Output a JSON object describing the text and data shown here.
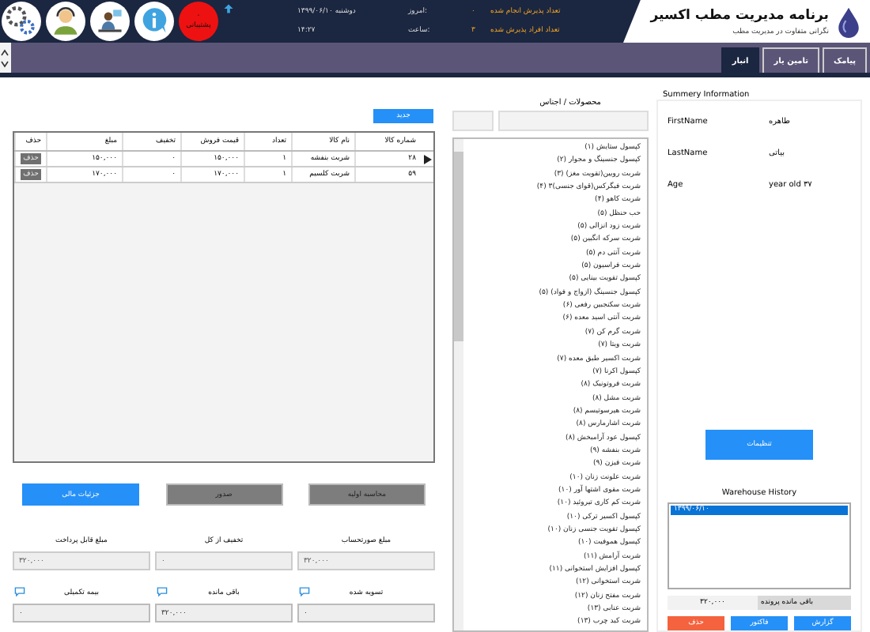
{
  "header": {
    "title": "برنامه مدیریت مطب اکسیر",
    "subtitle": "نگرانی متفاوت در مدیریت مطب",
    "stats": [
      {
        "label": "تعداد پذیرش انجام شده",
        "value": "۰"
      },
      {
        "label": "تعداد افراد پذیرش شده",
        "value": "۳"
      }
    ],
    "today": {
      "label": "امروز:",
      "value": "۱۳۹۹/۰۶/۱۰  دوشنبه"
    },
    "time": {
      "label": "ساعت:",
      "value": "۱۴:۲۷"
    },
    "support": {
      "count": "۰",
      "label": "پشتیبانی"
    }
  },
  "tabs": [
    {
      "label": "پیامک",
      "selected": false
    },
    {
      "label": "تامین یار",
      "selected": false
    },
    {
      "label": "انبار",
      "selected": true
    }
  ],
  "summary": {
    "title": "Summery Information",
    "fields": [
      {
        "label": "FirstName",
        "value": "طاهره"
      },
      {
        "label": "LastName",
        "value": "بیاتی"
      },
      {
        "label": "Age",
        "value": "year old ۳۷"
      }
    ],
    "settings_button": "تنظیمات",
    "history_title": "Warehouse History",
    "history": [
      {
        "label": "۱۳۹۹/۰۶/۱۰",
        "selected": true
      }
    ],
    "balance": {
      "label": "باقی مانده پرونده",
      "value": "۳۲۰,۰۰۰"
    },
    "buttons": [
      {
        "label": "گزارش",
        "kind": "primary"
      },
      {
        "label": "فاکتور",
        "kind": "primary"
      },
      {
        "label": "حذف",
        "kind": "danger"
      }
    ]
  },
  "products": {
    "title": "محصولات / اجناس",
    "items": [
      "کپسول ستایش (۱)",
      "کپسول جنسینگ و مجوار (۲)",
      "شربت رویین(تقویت مغز) (۳)",
      "شربت فیگرکس(قوای جنسی)۳ (۴)",
      "شربت کاهو (۴)",
      "حب حنظل (۵)",
      "شربت زود انزالی (۵)",
      "شربت سرکه انگبین (۵)",
      "شربت آنتی دم (۵)",
      "شربت فراسیون (۵)",
      "کپسول تقویت بینایی (۵)",
      "کپسول جنسینگ (ازواج و فواد) (۵)",
      "شربت سکنجبین رفعی (۶)",
      "شربت آنتی اسید معده (۶)",
      "شربت گرم کن (۷)",
      "شربت ویتا (۷)",
      "شربت اکسیر طبق معده (۷)",
      "کپسول اکرنا (۷)",
      "شربت فروتونیک (۸)",
      "شربت مشل (۸)",
      "شربت هیرسوتیسم (۸)",
      "شربت اشارمارس (۸)",
      "کپسول عود آرامبخش (۸)",
      "شربت بنفشه (۹)",
      "شربت فیزن (۹)",
      "شربت علونت زنان (۱۰)",
      "شربت مقوی اشتها آور (۱۰)",
      "شربت کم کاری تیروئید (۱۰)",
      "کپسول اکسیر ترکی (۱۰)",
      "کپسول تقویت جنسی زنان (۱۰)",
      "کپسول هموفیت (۱۰)",
      "شربت آرامش (۱۱)",
      "کپسول افزایش استخوانی (۱۱)",
      "شربت استخوانی (۱۲)",
      "شربت مفتح زنان (۱۲)",
      "شربت عنابی (۱۳)",
      "شربت کبد چرب (۱۳)"
    ]
  },
  "invoice": {
    "new_button": "جدید",
    "columns": [
      "شماره کالا",
      "نام کالا",
      "تعداد",
      "قیمت فروش",
      "تخفیف",
      "مبلغ",
      "حذف"
    ],
    "rows": [
      {
        "selected": true,
        "cells": [
          "۲۸",
          "شربت بنفشه",
          "۱",
          "۱۵۰,۰۰۰",
          "۰",
          "۱۵۰,۰۰۰"
        ],
        "action": "حذف"
      },
      {
        "selected": false,
        "cells": [
          "۵۹",
          "شربت کلسیم",
          "۱",
          "۱۷۰,۰۰۰",
          "۰",
          "۱۷۰,۰۰۰"
        ],
        "action": "حذف"
      }
    ],
    "actions": [
      {
        "label": "محاسبه اولیه",
        "kind": "secondary"
      },
      {
        "label": "صدور",
        "kind": "secondary"
      },
      {
        "label": "جزئیات مالی",
        "kind": "primary"
      }
    ],
    "fields": [
      {
        "label": "مبلغ صورتحساب",
        "value": "۳۲۰,۰۰۰",
        "chat": false
      },
      {
        "label": "تخفیف از کل",
        "value": "۰",
        "chat": false
      },
      {
        "label": "مبلغ قابل پرداخت",
        "value": "۳۲۰,۰۰۰",
        "chat": false
      },
      {
        "label": "تسویه شده",
        "value": "۰",
        "chat": true
      },
      {
        "label": "باقی مانده",
        "value": "۳۲۰,۰۰۰",
        "chat": true
      },
      {
        "label": "بیمه تکمیلی",
        "value": "۰",
        "chat": true
      }
    ]
  }
}
